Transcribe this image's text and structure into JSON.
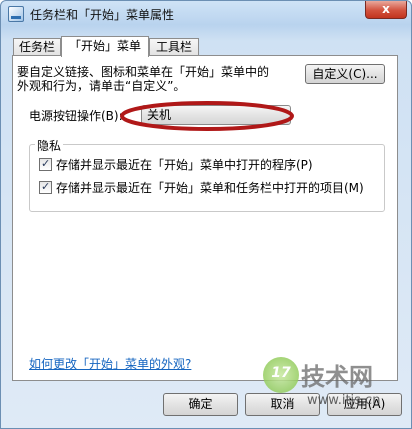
{
  "window": {
    "title": "任务栏和「开始」菜单属性",
    "close_glyph": "x"
  },
  "tabs": [
    {
      "label": "任务栏"
    },
    {
      "label": "「开始」菜单"
    },
    {
      "label": "工具栏"
    }
  ],
  "start_menu": {
    "description_line1": "要自定义链接、图标和菜单在「开始」菜单中的",
    "description_line2": "外观和行为，请单击“自定义”。",
    "customize_button": "自定义(C)...",
    "power_button_label": "电源按钮操作(B):",
    "power_button_value": "关机",
    "privacy_group_label": "隐私",
    "privacy_options": [
      {
        "label": "存储并显示最近在「开始」菜单中打开的程序(P)",
        "checked": true
      },
      {
        "label": "存储并显示最近在「开始」菜单和任务栏中打开的项目(M)",
        "checked": true
      }
    ],
    "help_link": "如何更改「开始」菜单的外观?"
  },
  "footer": {
    "ok_button": "确定",
    "cancel_button": "取消",
    "apply_button": "应用(A)"
  },
  "watermark": {
    "badge": "17",
    "brand": "技术网",
    "url": "www.itjs.cn"
  },
  "colors": {
    "highlight_ellipse": "#b01818",
    "link": "#1565c0",
    "close_button": "#c9402c"
  }
}
